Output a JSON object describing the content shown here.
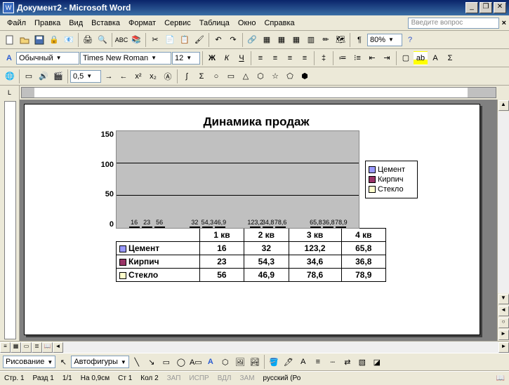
{
  "window": {
    "title": "Документ2 - Microsoft Word",
    "app_icon": "W"
  },
  "menu": [
    "Файл",
    "Правка",
    "Вид",
    "Вставка",
    "Формат",
    "Сервис",
    "Таблица",
    "Окно",
    "Справка"
  ],
  "menu_search_placeholder": "Введите вопрос",
  "toolbar2": {
    "style": "Обычный",
    "font": "Times New Roman",
    "size": "12"
  },
  "toolbar1": {
    "zoom": "80%"
  },
  "toolbar3": {
    "spacing": "0,5"
  },
  "drawing": {
    "label": "Рисование",
    "autoshapes": "Автофигуры"
  },
  "status": {
    "page_lbl": "Стр.",
    "page": "1",
    "sect_lbl": "Разд",
    "sect": "1",
    "pages": "1/1",
    "at_lbl": "На",
    "at": "0,9см",
    "ln_lbl": "Ст",
    "ln": "1",
    "col_lbl": "Кол",
    "col": "2",
    "rec": "ЗАП",
    "trk": "ИСПР",
    "ext": "ВДЛ",
    "ovr": "ЗАМ",
    "lang": "русский (Ро"
  },
  "chart_data": {
    "type": "bar",
    "title": "Динамика продаж",
    "categories": [
      "1 кв",
      "2 кв",
      "3 кв",
      "4 кв"
    ],
    "series": [
      {
        "name": "Цемент",
        "values": [
          16,
          32,
          123.2,
          65.8
        ],
        "labels": [
          "16",
          "32",
          "123,2",
          "65,8"
        ],
        "color": "#9999ff"
      },
      {
        "name": "Кирпич",
        "values": [
          23,
          54.3,
          34.8,
          36.8
        ],
        "labels": [
          "23",
          "54,3",
          "34,8",
          "36,8"
        ],
        "color": "#993366"
      },
      {
        "name": "Стекло",
        "values": [
          56,
          46.9,
          78.6,
          78.9
        ],
        "labels": [
          "56",
          "46,9",
          "78,6",
          "78,9"
        ],
        "color": "#ffffcc"
      }
    ],
    "ylim": [
      0,
      150
    ],
    "yticks": [
      0,
      50,
      100,
      150
    ],
    "table_rows": [
      {
        "name": "Цемент",
        "cells": [
          "16",
          "32",
          "123,2",
          "65,8"
        ],
        "sw": "c1"
      },
      {
        "name": "Кирпич",
        "cells": [
          "23",
          "54,3",
          "34,6",
          "36,8"
        ],
        "sw": "c2"
      },
      {
        "name": "Стекло",
        "cells": [
          "56",
          "46,9",
          "78,6",
          "78,9"
        ],
        "sw": "c3"
      }
    ]
  }
}
